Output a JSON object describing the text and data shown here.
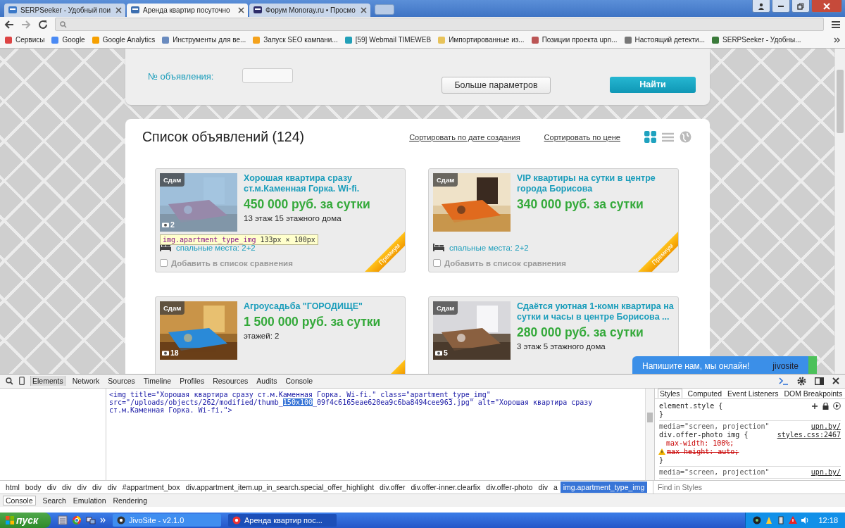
{
  "browser": {
    "tabs": [
      {
        "title": "SERPSeeker - Удобный пои",
        "selected": false
      },
      {
        "title": "Аренда квартир посуточно",
        "selected": true
      },
      {
        "title": "Форум Monoray.ru • Просмо",
        "selected": false
      }
    ],
    "bookmarks": [
      "Сервисы",
      "Google",
      "Google Analytics",
      "Инструменты для ве...",
      "Запуск SEO кампани...",
      "[59] Webmail TIMEWEB",
      "Импортированные из...",
      "Позиции проекта upn...",
      "Настоящий детекти...",
      "SERPSeeker - Удобны..."
    ]
  },
  "search_form": {
    "number_label": "№ объявления:",
    "more_button": "Больше параметров",
    "find_button": "Найти"
  },
  "listing": {
    "title": "Список объявлений (124)",
    "sort_links": [
      "Сортировать по дате создания",
      "Сортировать по цене"
    ],
    "view_modes": [
      {
        "kind": "grid",
        "selected": true
      },
      {
        "kind": "list",
        "selected": false
      },
      {
        "kind": "map",
        "selected": false
      }
    ]
  },
  "cards": [
    {
      "badge": "Сдам",
      "photo_count": "2",
      "title": "Хорошая квартира сразу ст.м.Каменная Горка. Wi-fi.",
      "price": "450 000 руб. за сутки",
      "floor": "13 этаж 15 этажного дома",
      "beds": "спальные места: 2+2",
      "compare": "Добавить в список сравнения",
      "compare_checked": false,
      "premium": true,
      "ribbon": "Премиум",
      "inspected": true
    },
    {
      "badge": "Сдам",
      "title": "VIP квартиры на сутки в центре города Борисова",
      "price": "340 000 руб. за сутки",
      "beds": "спальные места: 2+2",
      "compare": "Добавить в список сравнения",
      "compare_checked": false,
      "premium": true,
      "ribbon": "Премиум",
      "inspected": false
    },
    {
      "badge": "Сдам",
      "photo_count": "18",
      "title": "Агроусадьба \"ГОРОДИЩЕ\"",
      "price": "1 500 000 руб. за сутки",
      "floor": "этажей: 2",
      "premium": true,
      "inspected": false
    },
    {
      "badge": "Сдам",
      "photo_count": "5",
      "title": "Сдаётся уютная 1-комн квартира на сутки и часы в центре Борисова ...",
      "price": "280 000 руб. за сутки",
      "floor": "3 этаж 5 этажного дома",
      "inspected": false
    }
  ],
  "tooltip": {
    "selector": "img.apartment_type_img",
    "size": "133px × 100px"
  },
  "chat": {
    "text": "Напишите нам, мы онлайн!",
    "brand": "jivosite"
  },
  "devtools": {
    "tabs": [
      {
        "label": "Elements",
        "selected": true
      },
      {
        "label": "Network",
        "selected": false
      },
      {
        "label": "Sources",
        "selected": false
      },
      {
        "label": "Timeline",
        "selected": false
      },
      {
        "label": "Profiles",
        "selected": false
      },
      {
        "label": "Resources",
        "selected": false
      },
      {
        "label": "Audits",
        "selected": false
      },
      {
        "label": "Console",
        "selected": false
      }
    ],
    "source": {
      "before": "<img title=\"Хорошая квартира сразу ст.м.Каменная Горка. Wi-fi.\" class=\"apartment_type_img\" src=\"/uploads/objects/262/modified/thumb_",
      "selected": "150x100",
      "after": "_09f4c6165eae620ea9c6ba8494cee963.jpg\" alt=\"Хорошая квартира сразу ст.м.Каменная Горка. Wi-fi.\">"
    },
    "breadcrumbs": [
      {
        "label": "html",
        "selected": false
      },
      {
        "label": "body",
        "selected": false
      },
      {
        "label": "div",
        "selected": false
      },
      {
        "label": "div",
        "selected": false
      },
      {
        "label": "div",
        "selected": false
      },
      {
        "label": "div",
        "selected": false
      },
      {
        "label": "div",
        "selected": false
      },
      {
        "label": "#appartment_box",
        "selected": false
      },
      {
        "label": "div.appartment_item.up_in_search.special_offer_highlight",
        "selected": false
      },
      {
        "label": "div.offer",
        "selected": false
      },
      {
        "label": "div.offer-inner.clearfix",
        "selected": false
      },
      {
        "label": "div.offer-photo",
        "selected": false
      },
      {
        "label": "div",
        "selected": false
      },
      {
        "label": "a",
        "selected": false
      },
      {
        "label": "img.apartment_type_img",
        "selected": true
      }
    ],
    "style_tabs": [
      {
        "label": "Styles",
        "selected": true
      },
      {
        "label": "Computed",
        "selected": false
      },
      {
        "label": "Event Listeners",
        "selected": false
      },
      {
        "label": "DOM Breakpoints",
        "selected": false
      }
    ],
    "element_rule": {
      "selector": "element.style {",
      "close": "}"
    },
    "rules": [
      {
        "media": "media=\"screen, projection\"",
        "source": "upn.by/",
        "selector": "div.offer-photo img {",
        "file": "styles.css:2467",
        "props": [
          {
            "text": "max-width: 100%;",
            "overridden": false,
            "warning": false
          },
          {
            "text": "max-height: auto;",
            "overridden": true,
            "warning": true
          }
        ],
        "close": "}"
      },
      {
        "media": "media=\"screen, projection\"",
        "source": "upn.by/"
      }
    ],
    "find_placeholder": "Find in Styles",
    "drawer_tabs": [
      {
        "label": "Console",
        "selected": true
      },
      {
        "label": "Search",
        "selected": false
      },
      {
        "label": "Emulation",
        "selected": false
      },
      {
        "label": "Rendering",
        "selected": false
      }
    ]
  },
  "taskbar": {
    "start": "пуск",
    "tasks": [
      {
        "label": "JivoSite - v2.1.0",
        "selected": false
      },
      {
        "label": "Аренда квартир пос...",
        "selected": true
      }
    ],
    "clock": "12:18"
  }
}
